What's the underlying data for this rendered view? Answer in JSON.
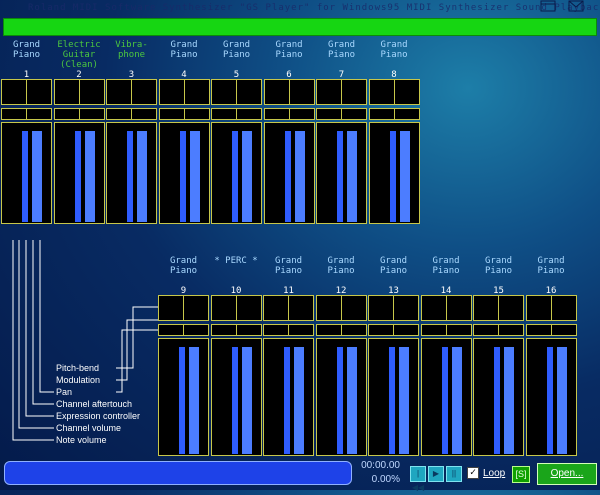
{
  "window": {
    "title": "Roland MIDI Software Synthesizer \"GS Player\" for Windows95 MIDI Synthesizer Sound Playback"
  },
  "top_row": [
    {
      "num": "1",
      "inst": [
        "Grand",
        "Piano",
        ""
      ],
      "green": false
    },
    {
      "num": "2",
      "inst": [
        "Electric",
        "Guitar",
        "(Clean)"
      ],
      "green": true
    },
    {
      "num": "3",
      "inst": [
        "Vibra-",
        "phone",
        ""
      ],
      "green": true
    },
    {
      "num": "4",
      "inst": [
        "Grand",
        "Piano",
        ""
      ],
      "green": false
    },
    {
      "num": "5",
      "inst": [
        "Grand",
        "Piano",
        ""
      ],
      "green": false
    },
    {
      "num": "6",
      "inst": [
        "Grand",
        "Piano",
        ""
      ],
      "green": false
    },
    {
      "num": "7",
      "inst": [
        "Grand",
        "Piano",
        ""
      ],
      "green": false
    },
    {
      "num": "8",
      "inst": [
        "Grand",
        "Piano",
        ""
      ],
      "green": false
    }
  ],
  "bottom_row": [
    {
      "num": "9",
      "inst": [
        "Grand",
        "Piano"
      ]
    },
    {
      "num": "10",
      "inst": [
        "* PERC *",
        ""
      ]
    },
    {
      "num": "11",
      "inst": [
        "Grand",
        "Piano"
      ]
    },
    {
      "num": "12",
      "inst": [
        "Grand",
        "Piano"
      ]
    },
    {
      "num": "13",
      "inst": [
        "Grand",
        "Piano"
      ]
    },
    {
      "num": "14",
      "inst": [
        "Grand",
        "Piano"
      ]
    },
    {
      "num": "15",
      "inst": [
        "Grand",
        "Piano"
      ]
    },
    {
      "num": "16",
      "inst": [
        "Grand",
        "Piano"
      ]
    }
  ],
  "legend": [
    "Pitch-bend",
    "Modulation",
    "Pan",
    "Channel aftertouch",
    "Expression controller",
    "Channel volume",
    "Note volume"
  ],
  "status": {
    "time": "00:00.00",
    "percent": "0.00%"
  },
  "controls": {
    "loop_label": "Loop",
    "loop_checked": "✓",
    "s_button": "[S]",
    "open_button": "Open...",
    "transport_buttons": [
      "|◀◀",
      "▶",
      "||"
    ]
  },
  "colors": {
    "meter_frame": "#c7c74a",
    "meter_bar": "#4c7dff",
    "top_bar": "#16d612",
    "status_box": "#1e42e8",
    "open_button": "#1aa51a"
  }
}
